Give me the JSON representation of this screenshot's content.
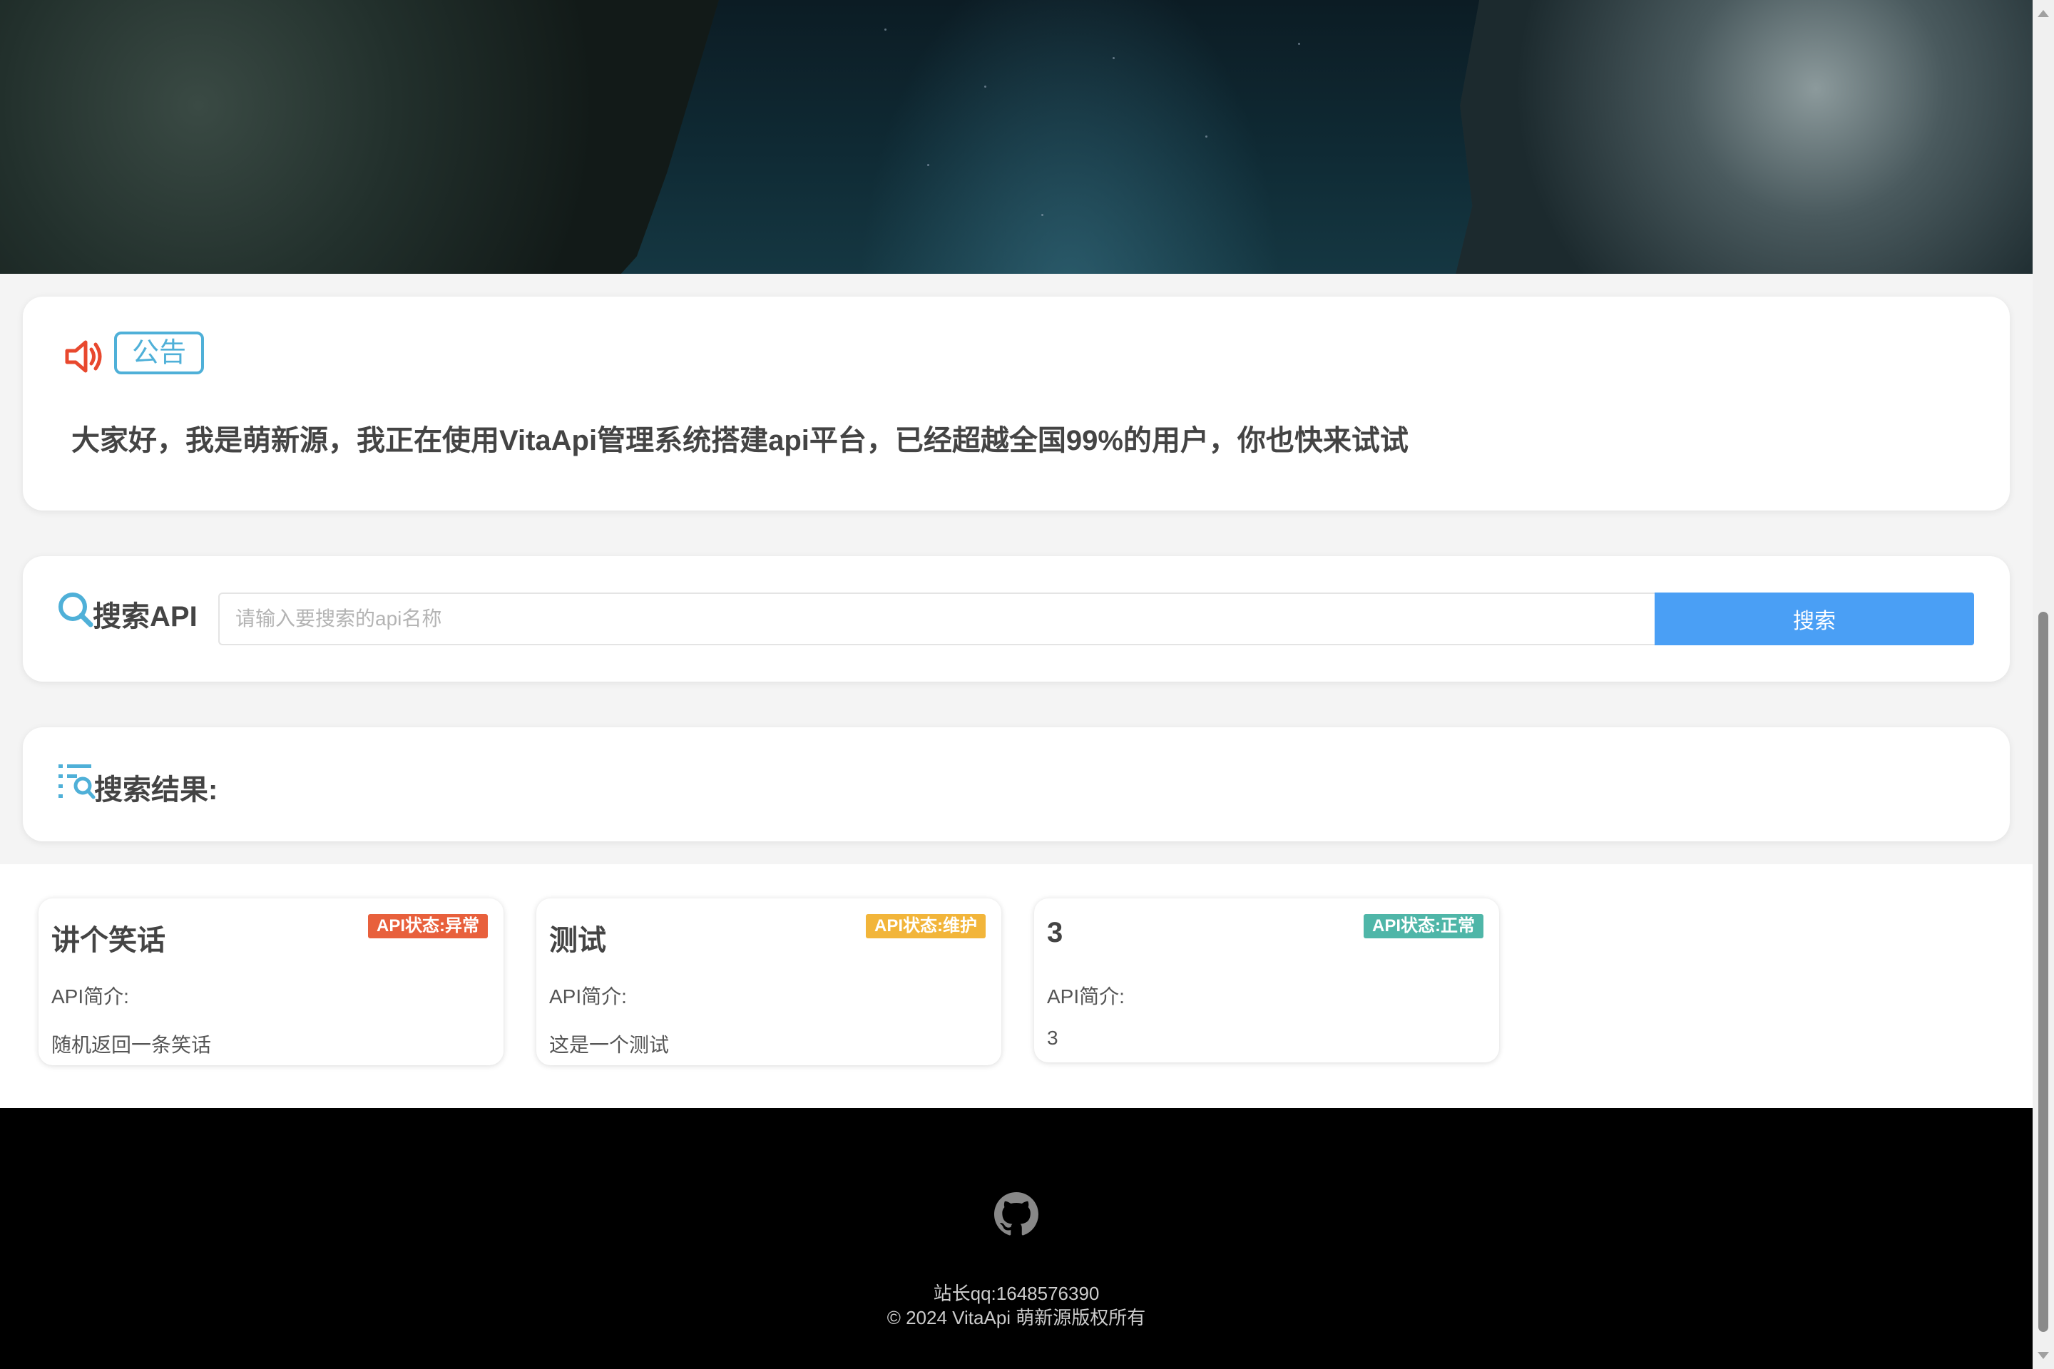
{
  "notice": {
    "tag": "公告",
    "text": "大家好，我是萌新源，我正在使用VitaApi管理系统搭建api平台，已经超越全国99%的用户，你也快来试试",
    "icon": "speaker-icon",
    "icon_color": "#e8482e"
  },
  "search": {
    "label": "搜索API",
    "placeholder": "请输入要搜索的api名称",
    "value": "",
    "button_label": "搜索",
    "icon": "search-icon",
    "button_color": "#4a9ff5"
  },
  "results": {
    "label": "搜索结果:",
    "icon": "list-search-icon"
  },
  "apis": [
    {
      "name": "讲个笑话",
      "status": "API状态:异常",
      "status_color": "#e8603c",
      "intro_label": "API简介:",
      "intro": "随机返回一条笑话"
    },
    {
      "name": "测试",
      "status": "API状态:维护",
      "status_color": "#f2b53a",
      "intro_label": "API简介:",
      "intro": "这是一个测试"
    },
    {
      "name": "3",
      "status": "API状态:正常",
      "status_color": "#4fb6a8",
      "intro_label": "API简介:",
      "intro": "3"
    }
  ],
  "footer": {
    "icon": "github-icon",
    "qq": "站长qq:1648576390",
    "copyright": "© 2024 VitaApi 萌新源版权所有"
  }
}
